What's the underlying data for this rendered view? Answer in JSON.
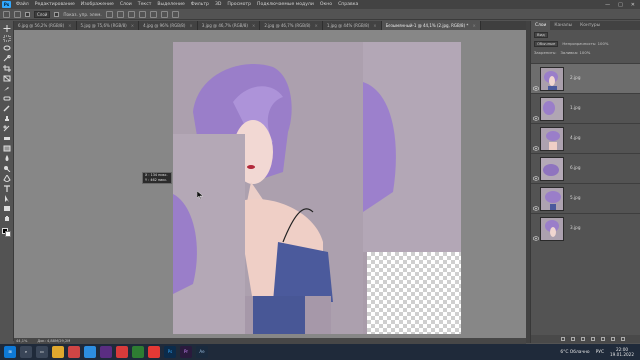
{
  "menubar": {
    "logo": "Ps",
    "items": [
      "Файл",
      "Редактирование",
      "Изображение",
      "Слои",
      "Текст",
      "Выделение",
      "Фильтр",
      "3D",
      "Просмотр",
      "Подключаемые модули",
      "Окно",
      "Справка"
    ],
    "controls": [
      "—",
      "□",
      "✕"
    ]
  },
  "options": {
    "select_value": "Слой",
    "show_controls": "Показ. упр. элем."
  },
  "tabs": [
    {
      "label": "6.jpg @ 56,2% (RGB/8)",
      "active": false
    },
    {
      "label": "5.jpg @ 75,6% (RGB/8)",
      "active": false
    },
    {
      "label": "4.jpg @ 96% (RGB/8)",
      "active": false
    },
    {
      "label": "3.jpg @ 46,7% (RGB/8)",
      "active": false
    },
    {
      "label": "2.jpg @ 46,7% (RGB/8)",
      "active": false
    },
    {
      "label": "1.jpg @ 44% (RGB/8)",
      "active": false
    },
    {
      "label": "Безымянный-1 @ 44,1% (2.jpg, RGB/8) *",
      "active": true
    }
  ],
  "tooltip": {
    "line1": "Х : 134 пикс.",
    "line2": "Y : 462 пикс."
  },
  "status": {
    "zoom": "44,1%",
    "doc": "Док: 4,88М/29,2М"
  },
  "layers": {
    "tabs": [
      "Слои",
      "Каналы",
      "Контуры"
    ],
    "filter": "Вид",
    "blend": "Обычные",
    "opacity_label": "Непрозрачность: 100%",
    "lock_label": "Закрепить:",
    "fill_label": "Заливка: 100%",
    "items": [
      {
        "name": "2.jpg",
        "selected": true
      },
      {
        "name": "1.jpg",
        "selected": false
      },
      {
        "name": "4.jpg",
        "selected": false
      },
      {
        "name": "6.jpg",
        "selected": false
      },
      {
        "name": "5.jpg",
        "selected": false
      },
      {
        "name": "3.jpg",
        "selected": false
      }
    ]
  },
  "taskbar": {
    "weather": "6°C  Облачно",
    "lang": "РУС",
    "time": "22:00",
    "date": "19.01.2022"
  },
  "colors": {
    "accent": "#31a8ff",
    "hair": "#9b7cc8",
    "background": "#a99caa",
    "dress": "#4b5a9c"
  }
}
